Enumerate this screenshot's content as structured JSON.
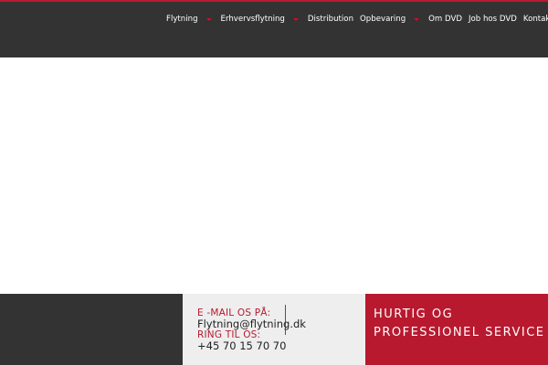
{
  "nav": {
    "items": [
      {
        "label": "Flytning",
        "dropdown": true
      },
      {
        "label": "Erhvervsflytning",
        "dropdown": true
      },
      {
        "label": "Distribution",
        "dropdown": false
      },
      {
        "label": "Opbevaring",
        "dropdown": true
      },
      {
        "label": "Om DVD",
        "dropdown": false
      },
      {
        "label": "Job hos DVD",
        "dropdown": false
      },
      {
        "label": "Kontakt",
        "dropdown": false
      }
    ]
  },
  "footer": {
    "email_label": "E -MAIL OS PÅ:",
    "email_value": "Flytning@flytning.dk",
    "phone_label": "RING TIL OS:",
    "phone_value": "+45 70 15 70 70",
    "tagline_line1": "HURTIG OG",
    "tagline_line2": "PROFESSIONEL SERVICE"
  },
  "colors": {
    "header_bg": "#333333",
    "accent": "#b8192f",
    "contact_bg": "#eeeeee"
  }
}
